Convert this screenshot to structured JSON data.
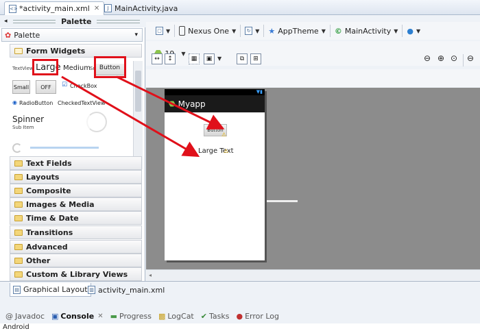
{
  "editor_tabs": [
    {
      "label": "*activity_main.xml",
      "active": true
    },
    {
      "label": "MainActivity.java",
      "active": false
    }
  ],
  "palette": {
    "header": "Palette",
    "dropdown": "Palette",
    "form_widgets_label": "Form Widgets",
    "widgets": {
      "textview": "TextView",
      "large": "Large",
      "medium": "Medium",
      "small": "Small",
      "button": "Button",
      "small_button": "Small",
      "toggle": "OFF",
      "checkbox": "CheckBox",
      "radiobutton": "RadioButton",
      "checkedtextview": "CheckedTextView",
      "spinner": "Spinner",
      "sub_item": "Sub Item"
    },
    "categories": [
      "Text Fields",
      "Layouts",
      "Composite",
      "Images & Media",
      "Time & Date",
      "Transitions",
      "Advanced",
      "Other",
      "Custom & Library Views"
    ]
  },
  "toolbar": {
    "device": "Nexus One",
    "theme": "AppTheme",
    "activity": "MainActivity",
    "api_level": "19"
  },
  "device_preview": {
    "app_title": "Myapp",
    "button_label": "Button",
    "large_text": "Large Text"
  },
  "bottom_tabs": [
    {
      "label": "Graphical Layout",
      "active": true
    },
    {
      "label": "activity_main.xml",
      "active": false
    }
  ],
  "console_tabs": [
    {
      "label": "Javadoc",
      "active": false
    },
    {
      "label": "Console",
      "active": true
    },
    {
      "label": "Progress",
      "active": false
    },
    {
      "label": "LogCat",
      "active": false
    },
    {
      "label": "Tasks",
      "active": false
    },
    {
      "label": "Error Log",
      "active": false
    }
  ],
  "console_text": "Android",
  "colors": {
    "annotation": "#e0101a",
    "canvas": "#8c8c8c"
  }
}
